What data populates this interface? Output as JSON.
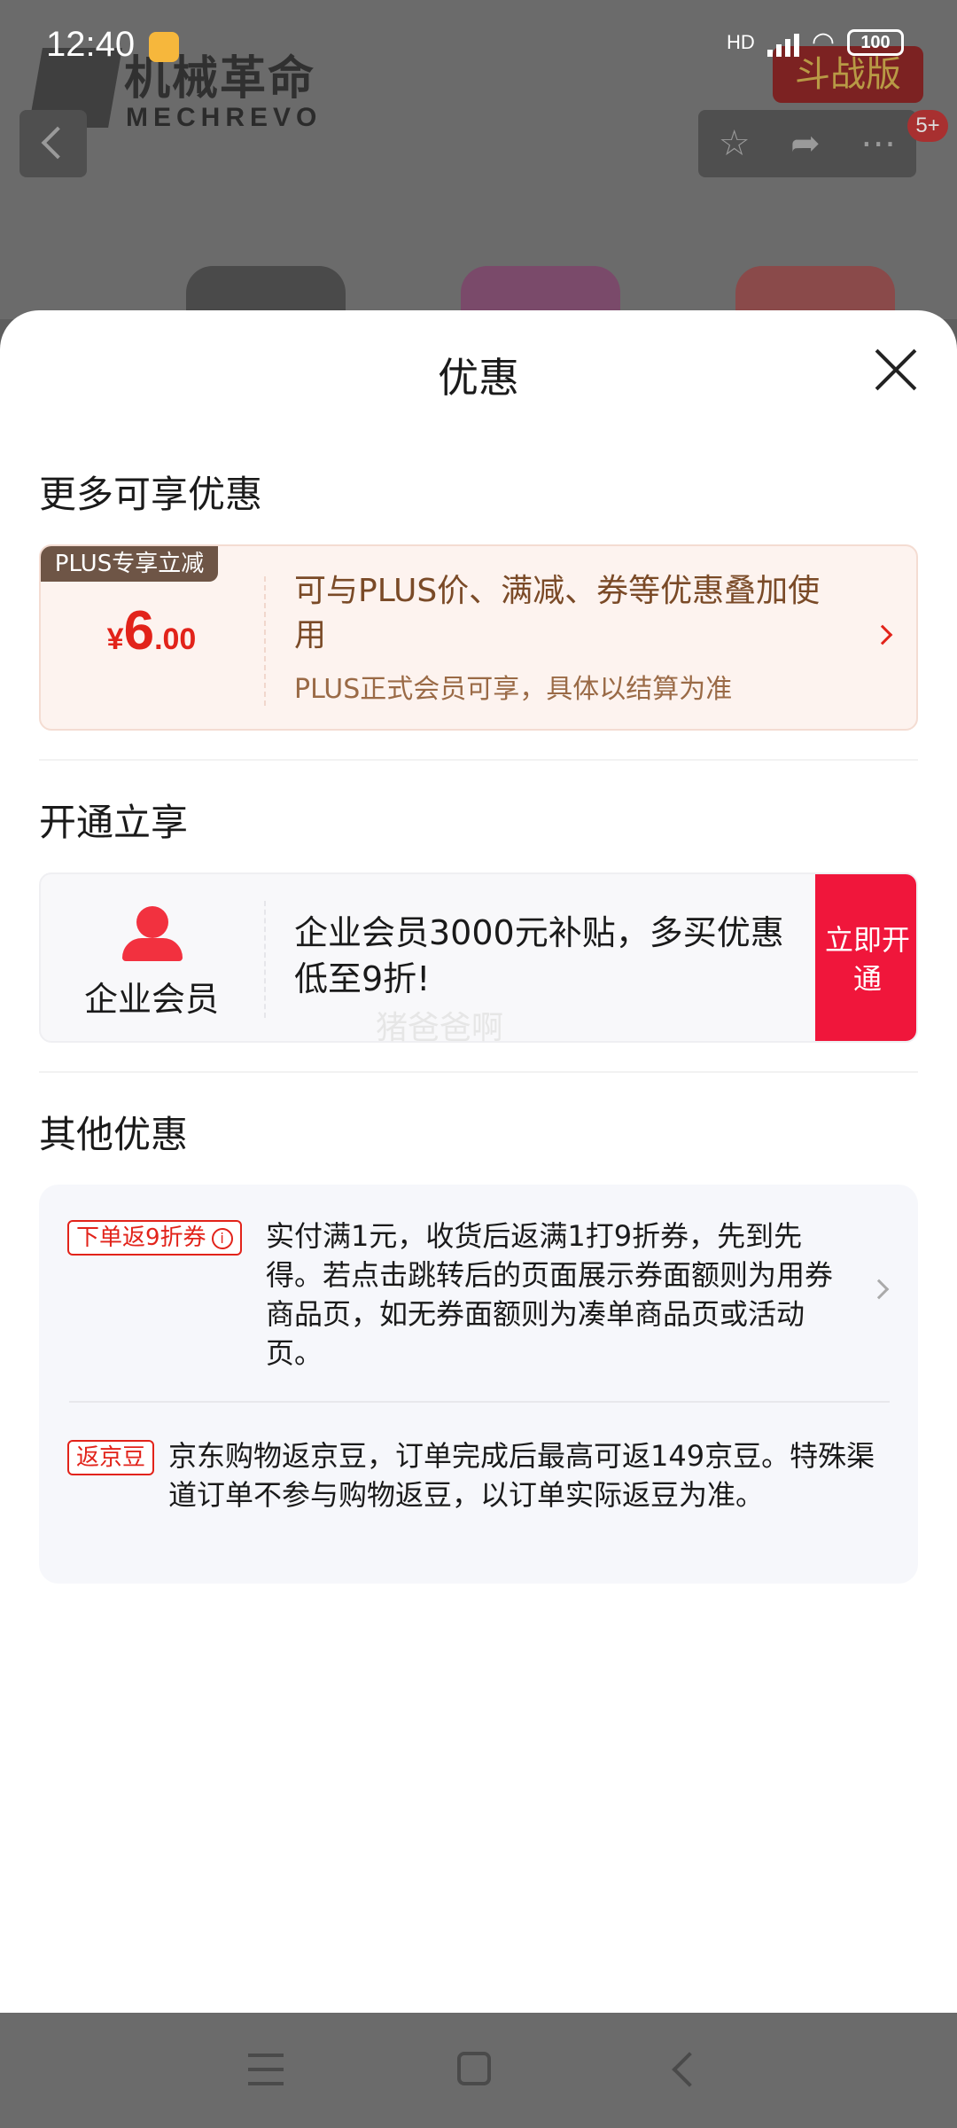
{
  "status_bar": {
    "time": "12:40",
    "network": "HD",
    "battery": "100"
  },
  "background": {
    "brand_name": "机械革命",
    "brand_sub": "MECHREVO",
    "tag": "斗战版",
    "badge": "5+",
    "actions": [
      "star-icon",
      "share-icon",
      "more-icon"
    ]
  },
  "sheet": {
    "title": "优惠",
    "more_offers": {
      "title": "更多可享优惠",
      "tag": "PLUS专享立减",
      "price_symbol": "¥",
      "price_int": "6",
      "price_dec": ".00",
      "desc": "可与PLUS价、满减、券等优惠叠加使用",
      "sub": "PLUS正式会员可享，具体以结算为准"
    },
    "open_now": {
      "title": "开通立享",
      "label": "企业会员",
      "desc": "企业会员3000元补贴，多买优惠低至9折!",
      "button": "立即开通",
      "watermark": "猪爸爸啊"
    },
    "other_offers": {
      "title": "其他优惠",
      "items": [
        {
          "tag": "下单返9折券",
          "text": "实付满1元，收货后返满1打9折券，先到先得。若点击跳转后的页面展示券面额则为用券商品页，如无券面额则为凑单商品页或活动页。"
        },
        {
          "tag": "返京豆",
          "text": "京东购物返京豆，订单完成后最高可返149京豆。特殊渠道订单不参与购物返豆，以订单实际返豆为准。"
        }
      ]
    }
  },
  "colors": {
    "accent_red": "#e2231a",
    "button_red": "#f0163b",
    "plus_brown": "#6e5546"
  }
}
